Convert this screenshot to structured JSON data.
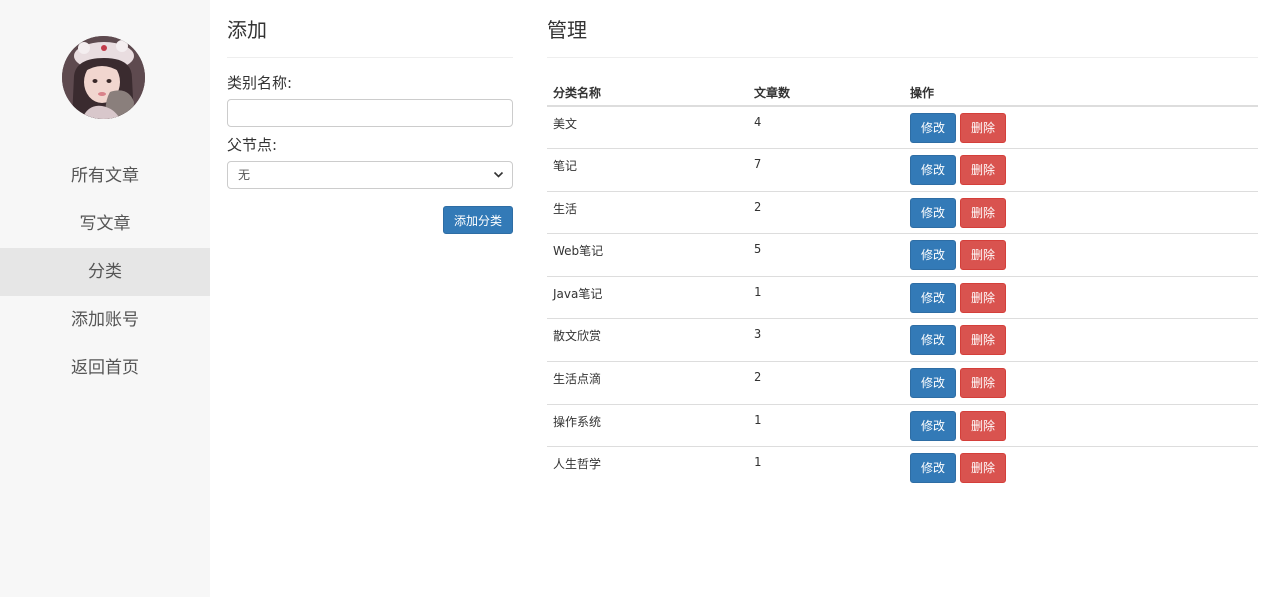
{
  "sidebar": {
    "items": [
      {
        "label": "所有文章",
        "active": false
      },
      {
        "label": "写文章",
        "active": false
      },
      {
        "label": "分类",
        "active": true
      },
      {
        "label": "添加账号",
        "active": false
      },
      {
        "label": "返回首页",
        "active": false
      }
    ]
  },
  "add_panel": {
    "title": "添加",
    "name_label": "类别名称:",
    "name_value": "",
    "parent_label": "父节点:",
    "parent_selected": "无",
    "submit_label": "添加分类"
  },
  "manage_panel": {
    "title": "管理",
    "columns": [
      "分类名称",
      "文章数",
      "操作"
    ],
    "edit_label": "修改",
    "delete_label": "删除",
    "rows": [
      {
        "name": "美文",
        "count": "4"
      },
      {
        "name": "笔记",
        "count": "7"
      },
      {
        "name": "生活",
        "count": "2"
      },
      {
        "name": "Web笔记",
        "count": "5"
      },
      {
        "name": "Java笔记",
        "count": "1"
      },
      {
        "name": "散文欣赏",
        "count": "3"
      },
      {
        "name": "生活点滴",
        "count": "2"
      },
      {
        "name": "操作系统",
        "count": "1"
      },
      {
        "name": "人生哲学",
        "count": "1"
      }
    ]
  },
  "colors": {
    "primary": "#337ab7",
    "danger": "#d9534f",
    "sidebar_bg": "#f7f7f7",
    "active_bg": "#e6e6e6"
  },
  "icons": {
    "select_arrow": "chevron-down-icon"
  }
}
